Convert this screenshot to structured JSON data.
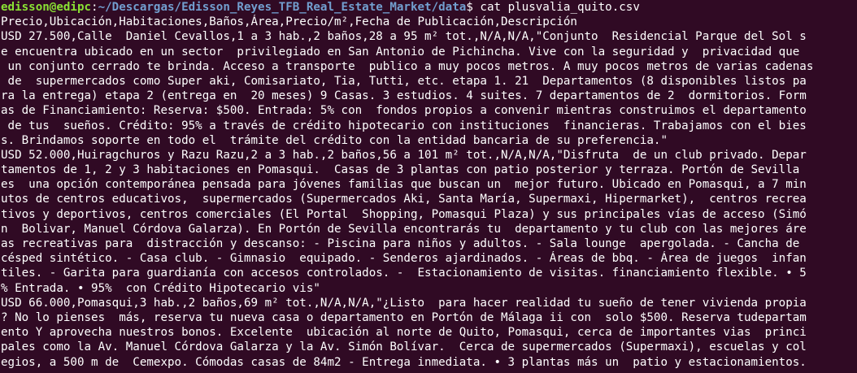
{
  "prompt": {
    "user_host": "edisson@edipc",
    "separator": ":",
    "cwd": "~/Descargas/Edisson_Reyes_TFB_Real_Estate_Market/data",
    "symbol": "$ ",
    "command": "cat plusvalia_quito.csv"
  },
  "colors": {
    "background": "#300a24",
    "foreground": "#ffffff",
    "user_host": "#8ae234",
    "path": "#729fcf"
  },
  "output": [
    "Precio,Ubicación,Habitaciones,Baños,Área,Precio/m²,Fecha de Publicación,Descripción",
    "USD 27.500,Calle  Daniel Cevallos,1 a 3 hab.,2 baños,28 a 95 m² tot.,N/A,N/A,\"Conjunto  Residencial Parque del Sol s",
    "e encuentra ubicado en un sector  privilegiado en San Antonio de Pichincha. Vive con la seguridad y  privacidad que",
    " un conjunto cerrado te brinda. Acceso a transporte  publico a muy pocos metros. A muy pocos metros de varias cadenas",
    " de  supermercados como Super aki, Comisariato, Tia, Tutti, etc. etapa 1. 21  Departamentos (8 disponibles listos pa",
    "ra la entrega) etapa 2 (entrega en  20 meses) 9 Casas. 3 estudios. 4 suites. 7 departamentos de 2  dormitorios. Form",
    "as de Financiamiento: Reserva: $500. Entrada: 5% con  fondos propios a convenir mientras construimos el departamento",
    " de tus  sueños. Crédito: 95% a través de crédito hipotecario con instituciones  financieras. Trabajamos con el bies",
    "s. Brindamos soporte en todo el  trámite del crédito con la entidad bancaria de su preferencia.\"",
    "USD 52.000,Huiragchuros y Razu Razu,2 a 3 hab.,2 baños,56 a 101 m² tot.,N/A,N/A,\"Disfruta  de un club privado. Depar",
    "tamentos de 1, 2 y 3 habitaciones en Pomasqui.  Casas de 3 plantas con patio posterior y terraza. Portón de Sevilla",
    "es  una opción contemporánea pensada para jóvenes familias que buscan un  mejor futuro. Ubicado en Pomasqui, a 7 min",
    "utos de centros educativos,  supermercados (Supermercados Aki, Santa María, Supermaxi, Hipermarket),  centros recrea",
    "tivos y deportivos, centros comerciales (El Portal  Shopping, Pomasqui Plaza) y sus principales vías de acceso (Simó",
    "n  Bolivar, Manuel Córdova Galarza). En Portón de Sevilla encontrarás tu  departamento y tu club con las mejores áre",
    "as recreativas para  distracción y descanso: - Piscina para niños y adultos. - Sala lounge  apergolada. - Cancha de",
    "césped sintético. - Casa club. - Gimnasio  equipado. - Senderos ajardinados. - Áreas de bbq. - Área de juegos  infan",
    "tiles. - Garita para guardianía con accesos controlados. -  Estacionamiento de visitas. financiamiento flexible. • 5",
    "% Entrada. • 95%  con Crédito Hipotecario vis\"",
    "USD 66.000,Pomasqui,3 hab.,2 baños,69 m² tot.,N/A,N/A,\"¿Listo  para hacer realidad tu sueño de tener vivienda propia",
    "? No lo pienses  más, reserva tu nueva casa o departamento en Portón de Málaga ii con  solo $500. Reserva tudepartam",
    "ento Y aprovecha nuestros bonos. Excelente  ubicación al norte de Quito, Pomasqui, cerca de importantes vias  princi",
    "pales como la Av. Manuel Córdova Galarza y la Av. Simón Bolívar.  Cerca de supermercados (Supermaxi), escuelas y col",
    "egios, a 500 m de  Cemexpo. Cómodas casas de 84m2 - Entrega inmediata. • 3 plantas más un  patio y estacionamientos."
  ]
}
